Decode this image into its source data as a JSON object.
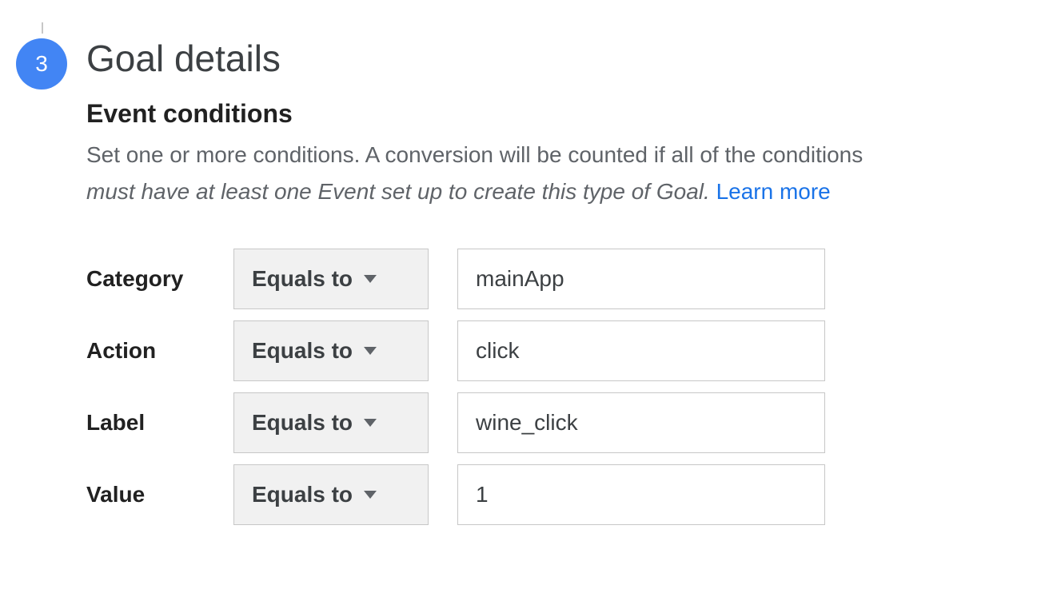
{
  "step": {
    "number": "3",
    "heading": "Goal details"
  },
  "section": {
    "subheading": "Event conditions",
    "description": "Set one or more conditions. A conversion will be counted if all of the conditions",
    "hint": "must have at least one Event set up to create this type of Goal.",
    "learn_more": "Learn more"
  },
  "conditions": [
    {
      "label": "Category",
      "operator": "Equals to",
      "value": "mainApp"
    },
    {
      "label": "Action",
      "operator": "Equals to",
      "value": "click"
    },
    {
      "label": "Label",
      "operator": "Equals to",
      "value": "wine_click"
    },
    {
      "label": "Value",
      "operator": "Equals to",
      "value": "1"
    }
  ]
}
